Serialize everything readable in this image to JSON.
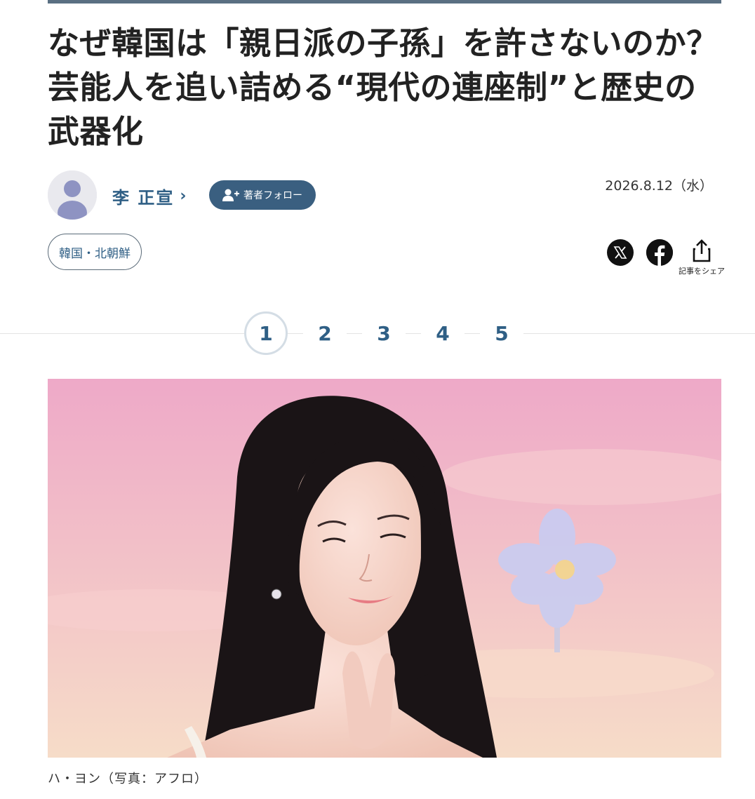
{
  "article": {
    "title": "なぜ韓国は「親日派の子孫」を許さないのか？芸能人を追い詰める“現代の連座制”と歴史の武器化",
    "author": "李 正宣",
    "author_chevron": "›",
    "follow_label": "著者フォロー",
    "date": "2026.8.12（水）",
    "tag": "韓国・北朝鮮",
    "share_label": "記事をシェア",
    "pages": [
      "1",
      "2",
      "3",
      "4",
      "5"
    ],
    "current_page": "1",
    "caption": "ハ・ヨン（写真：アフロ）"
  },
  "icons": {
    "author_avatar": "person-avatar-icon",
    "follow": "person-add-icon",
    "x": "x-logo-icon",
    "facebook": "facebook-logo-icon",
    "share": "share-icon"
  },
  "colors": {
    "accent": "#2f5f85",
    "follow_button": "#3a5f80",
    "top_rule": "#5a6f82"
  }
}
